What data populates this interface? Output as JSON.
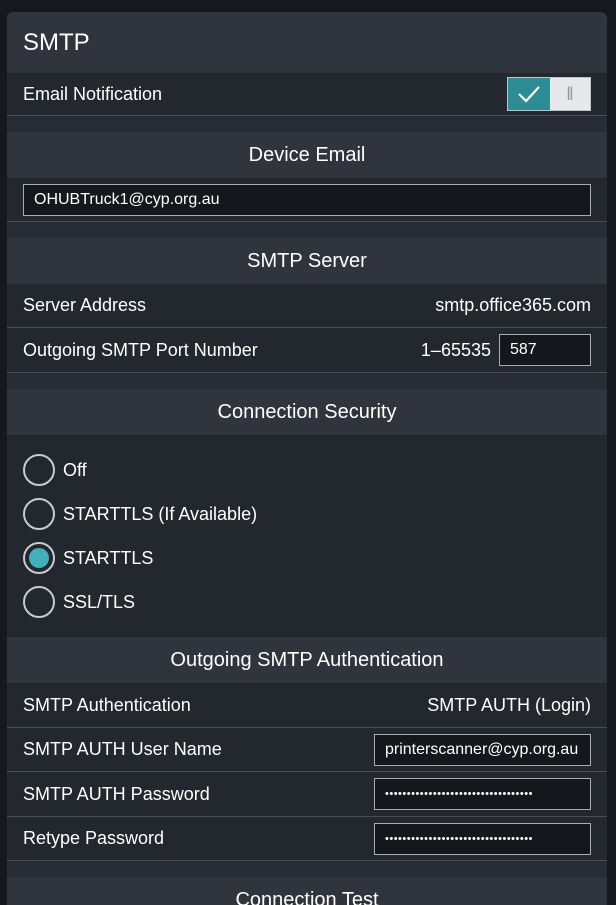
{
  "panel": {
    "title": "SMTP"
  },
  "email_notification": {
    "label": "Email Notification",
    "enabled": true,
    "on_color": "#2d8d94"
  },
  "device_email": {
    "header": "Device Email",
    "value": "OHUBTruck1@cyp.org.au"
  },
  "smtp_server": {
    "header": "SMTP Server",
    "server_address_label": "Server Address",
    "server_address_value": "smtp.office365.com",
    "port_label": "Outgoing SMTP Port Number",
    "port_range": "1–65535",
    "port_value": "587"
  },
  "connection_security": {
    "header": "Connection Security",
    "options": [
      "Off",
      "STARTTLS (If Available)",
      "STARTTLS",
      "SSL/TLS"
    ],
    "selected": "STARTTLS",
    "accent_color": "#3fb0bc"
  },
  "outgoing_auth": {
    "header": "Outgoing SMTP Authentication",
    "auth_label": "SMTP Authentication",
    "auth_value": "SMTP AUTH (Login)",
    "username_label": "SMTP AUTH User Name",
    "username_value": "printerscanner@cyp.org.au",
    "password_label": "SMTP AUTH Password",
    "password_mask": "••••••••••••••••••••••••••••••••••",
    "retype_label": "Retype Password",
    "retype_mask": "••••••••••••••••••••••••••••••••••"
  },
  "connection_test": {
    "header": "Connection Test"
  }
}
